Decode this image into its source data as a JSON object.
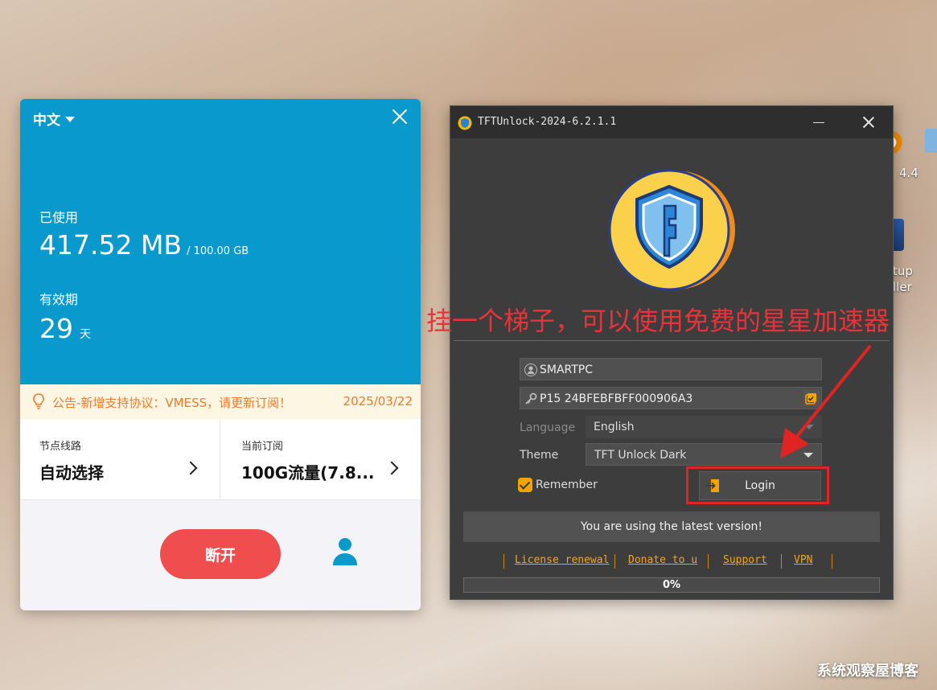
{
  "vpn": {
    "language": "中文",
    "used_label": "已使用",
    "used_value": "417.52 MB",
    "used_total": "/ 100.00 GB",
    "valid_label": "有效期",
    "valid_value": "29",
    "valid_unit": "天",
    "notice_text": "公告-新增支持协议：VMESS，请更新订阅！",
    "notice_date": "2025/03/22",
    "route_label": "节点线路",
    "route_value": "自动选择",
    "sub_label": "当前订阅",
    "sub_value": "100G流量(7.8...",
    "disconnect_label": "断开"
  },
  "tft": {
    "title": "TFTUnlock-2024-6.2.1.1",
    "username": "SMARTPC",
    "key": "P15 24BFEBFBFF000906A3",
    "language_label": "Language",
    "language_value": "English",
    "theme_label": "Theme",
    "theme_value": "TFT Unlock Dark",
    "remember_label": "Remember",
    "login_label": "Login",
    "status": "You are using the latest version!",
    "links": [
      "License renewal",
      "Donate to u",
      "Support",
      "VPN"
    ],
    "progress": "0%"
  },
  "overlay": {
    "annotation": "挂一个梯子，可以使用免费的星星加速器",
    "watermark": "系统观察屋博客"
  },
  "desktop": {
    "labels": [
      "4.4",
      "tup",
      "ller"
    ]
  },
  "colors": {
    "vpn_blue": "#0a99cc",
    "disconnect_red": "#f04e4e",
    "notice_orange": "#f07a2a",
    "tft_bg": "#3d3d3d",
    "accent_orange": "#f5a300",
    "annotation_red": "#e8333a"
  }
}
